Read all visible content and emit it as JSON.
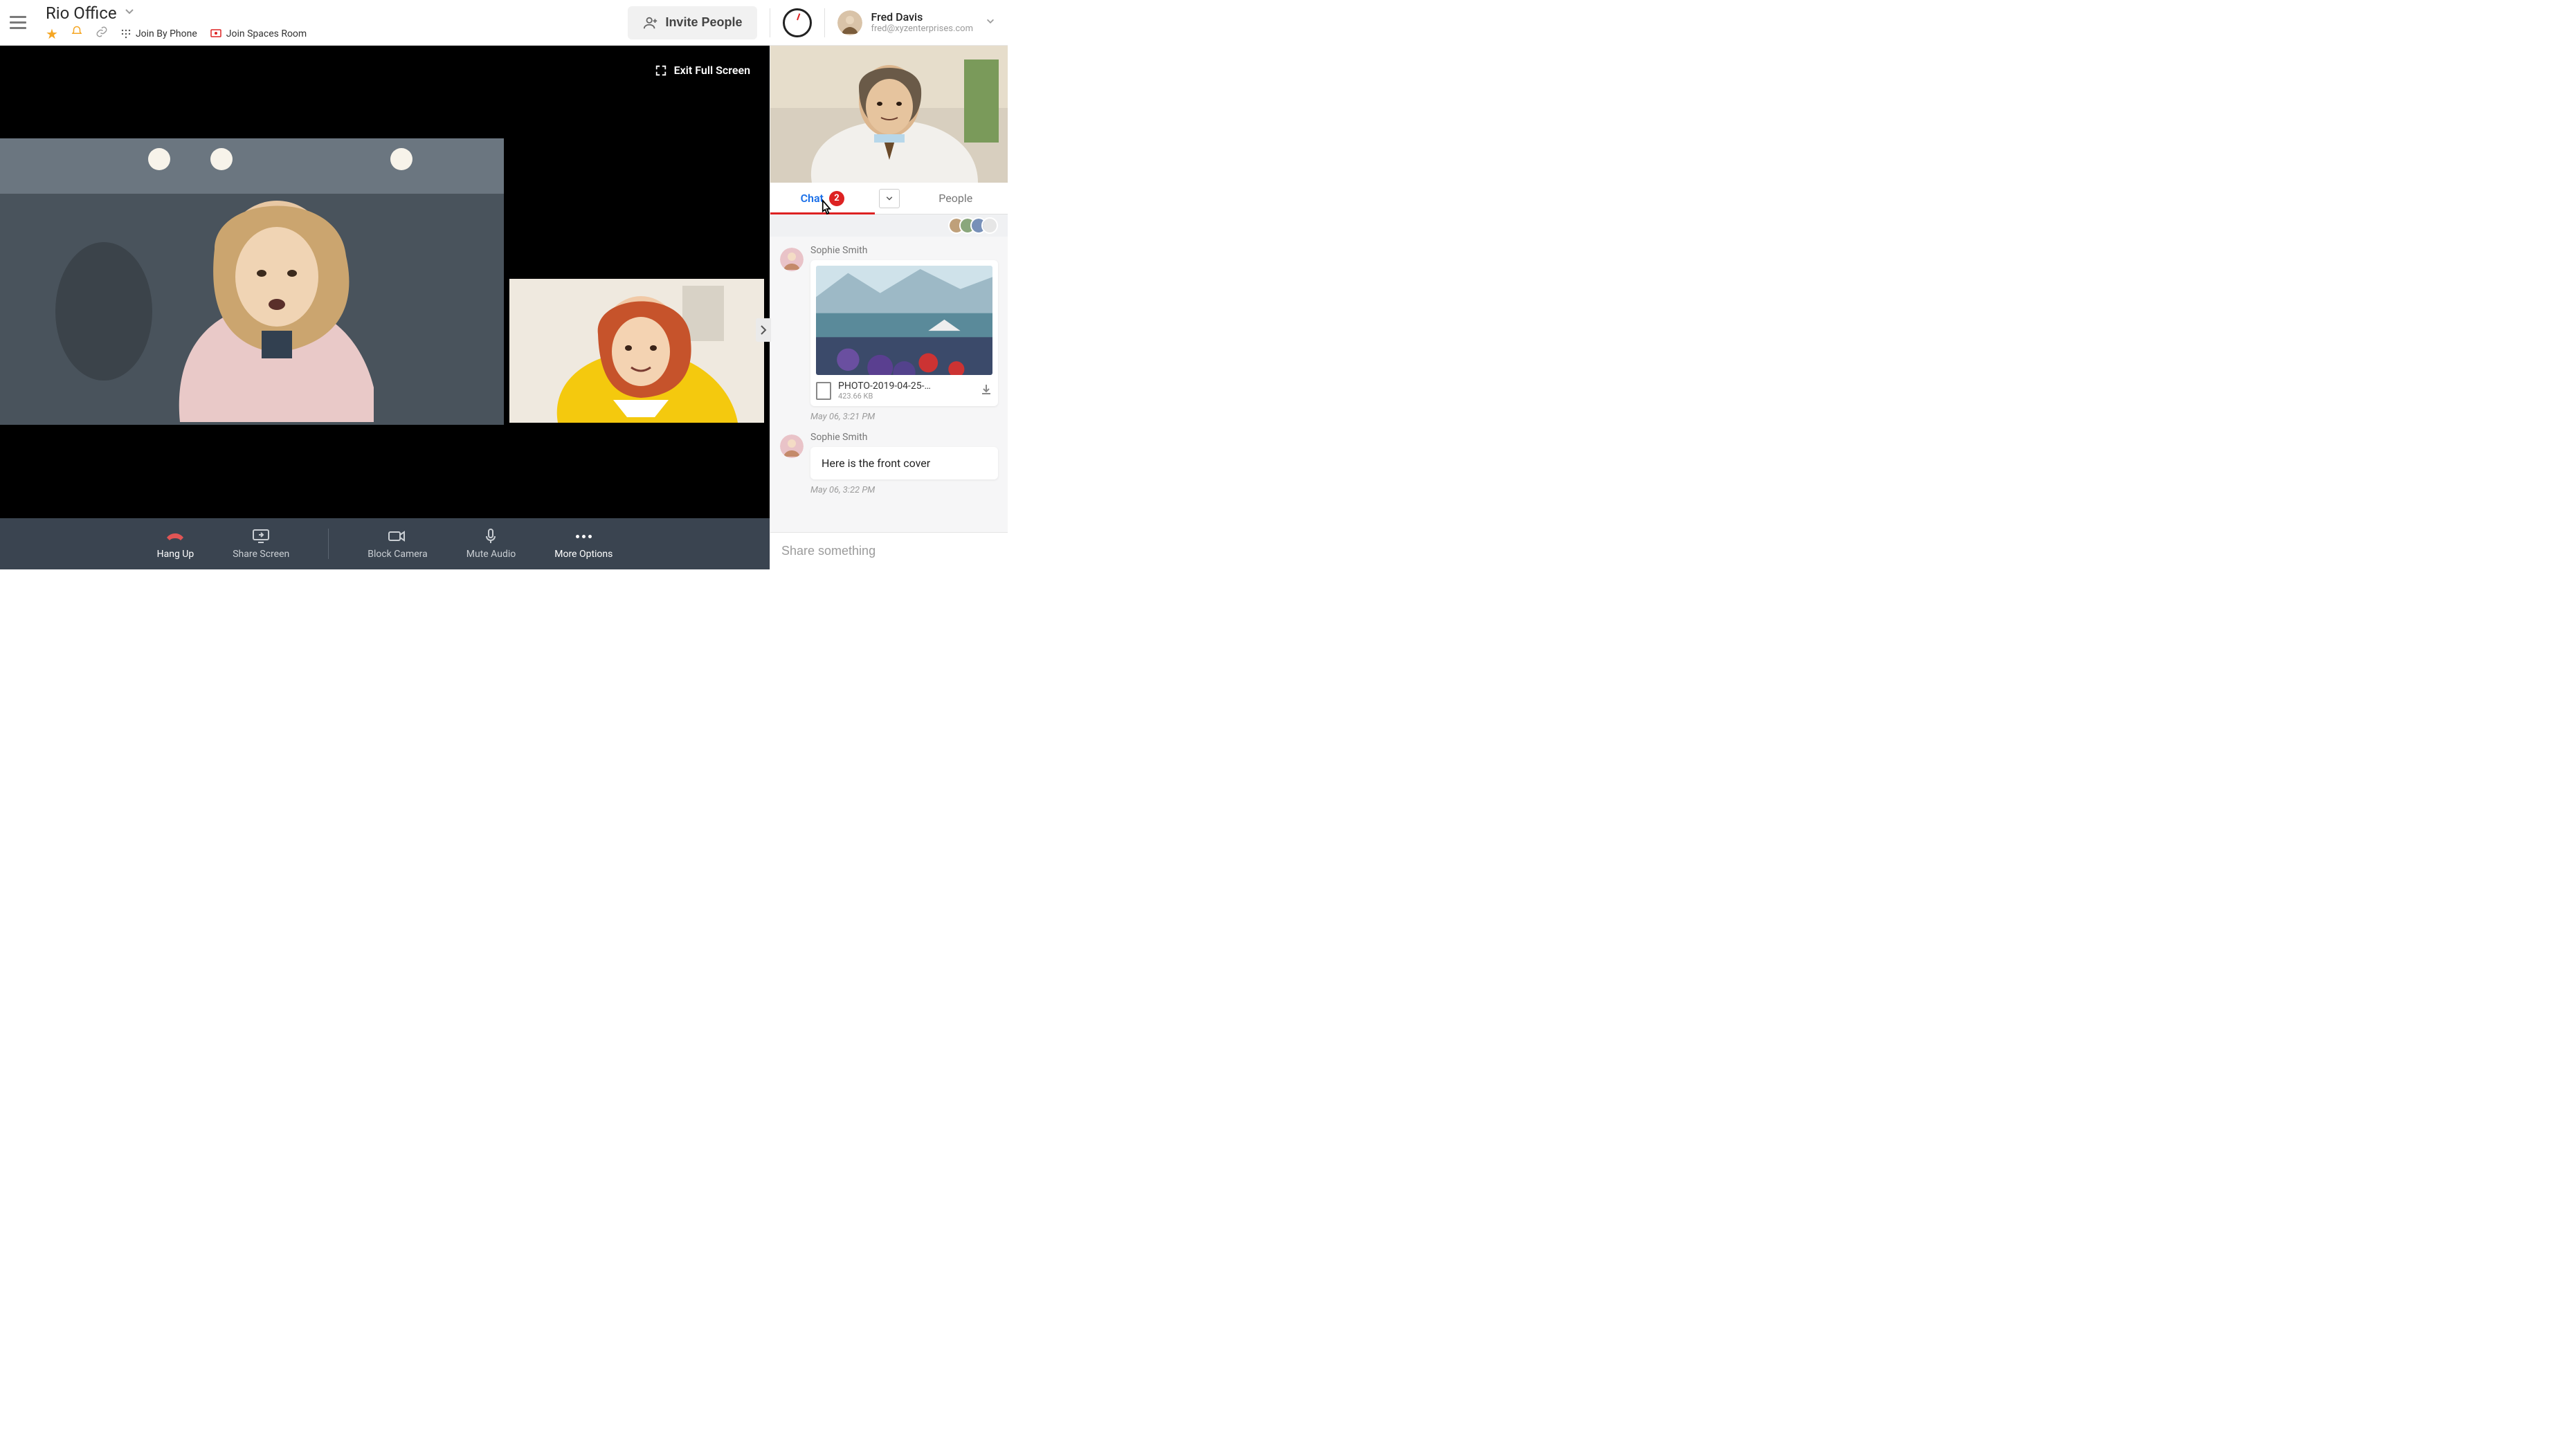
{
  "header": {
    "room_title": "Rio Office",
    "actions": {
      "join_phone": "Join By Phone",
      "join_spaces": "Join Spaces Room"
    },
    "invite_label": "Invite People",
    "user": {
      "name": "Fred Davis",
      "email": "fred@xyzenterprises.com"
    }
  },
  "video": {
    "exit_fullscreen": "Exit Full Screen"
  },
  "callbar": {
    "hang_up": "Hang Up",
    "share_screen": "Share Screen",
    "block_camera": "Block Camera",
    "mute_audio": "Mute Audio",
    "more_options": "More Options"
  },
  "side": {
    "tabs": {
      "chat": "Chat",
      "chat_badge": "2",
      "people": "People"
    },
    "messages": [
      {
        "sender": "Sophie Smith",
        "file_name": "PHOTO-2019-04-25-…",
        "file_size": "423.66 KB",
        "timestamp": "May 06, 3:21 PM"
      },
      {
        "sender": "Sophie Smith",
        "text": "Here is the front cover",
        "timestamp": "May 06, 3:22 PM"
      }
    ],
    "compose_placeholder": "Share something"
  },
  "icons": {
    "hamburger": "menu-icon",
    "star": "star-icon",
    "bell": "bell-icon",
    "link": "link-icon",
    "phone": "dialpad-icon",
    "spaces": "spaces-room-icon",
    "invite_person": "person-plus-icon",
    "clock": "clock-icon",
    "chevron_down": "chevron-down-icon",
    "collapse": "collapse-icon",
    "chevron_right": "chevron-right-icon",
    "hangup": "phone-down-icon",
    "share": "screen-share-icon",
    "camera": "camera-icon",
    "mic": "mic-icon",
    "more": "more-icon",
    "download": "download-icon",
    "image_doc": "image-file-icon"
  },
  "colors": {
    "accent_blue": "#1a6fe8",
    "badge_red": "#d22",
    "star_orange": "#f5a623",
    "hangup_red": "#e05555",
    "callbar_bg": "#3a4450"
  }
}
